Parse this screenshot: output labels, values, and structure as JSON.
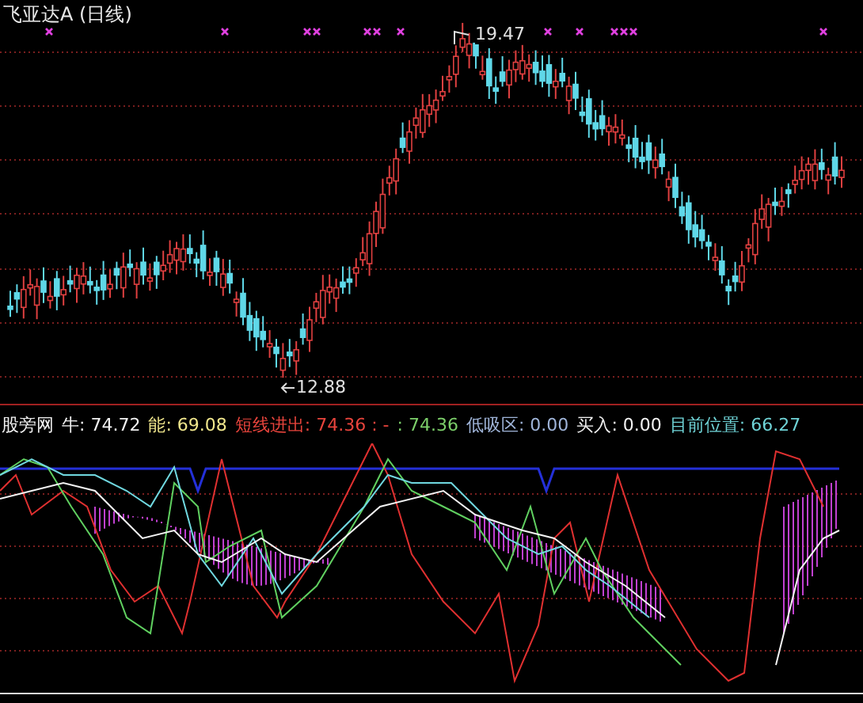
{
  "title": "飞亚达A (日线)",
  "price_labels": [
    {
      "kind": "high",
      "text": "19.47"
    },
    {
      "kind": "low",
      "text": "12.88"
    }
  ],
  "indicator": {
    "name": "股旁网",
    "segments": [
      {
        "text": "牛: 74.72",
        "color": "#f2f2f2"
      },
      {
        "text": "能: 69.08",
        "color": "#f0e68c"
      },
      {
        "text": "短线进出: 74.36 : -",
        "color": "#e8443c"
      },
      {
        "text": ": 74.36",
        "color": "#7ccf6a"
      },
      {
        "text": "低吸区: 0.00",
        "color": "#9fb4d8"
      },
      {
        "text": "买入: 0.00",
        "color": "#f2f2f2"
      },
      {
        "text": "目前位置: 66.27",
        "color": "#6fd3d6"
      }
    ]
  }
}
